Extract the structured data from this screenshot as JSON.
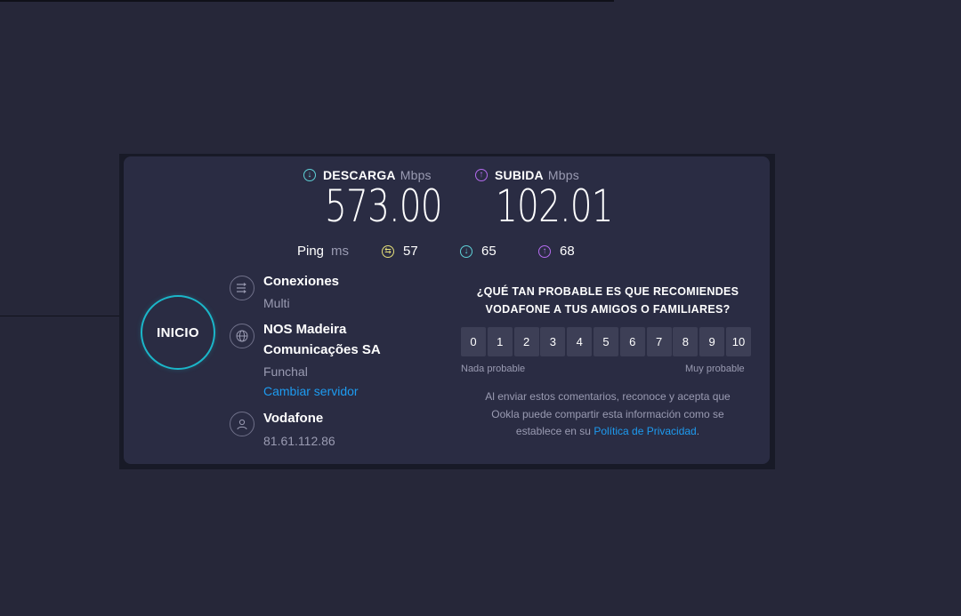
{
  "download": {
    "label": "DESCARGA",
    "unit": "Mbps",
    "value": "573.00",
    "icon": "arrow-down-circle-icon",
    "color": "#5fd1d8"
  },
  "upload": {
    "label": "SUBIDA",
    "unit": "Mbps",
    "value": "102.01",
    "icon": "arrow-up-circle-icon",
    "color": "#b56cf0"
  },
  "ping": {
    "label": "Ping",
    "unit": "ms",
    "idle": {
      "value": "57",
      "icon": "jitter-icon",
      "color": "#e6e07a"
    },
    "download": {
      "value": "65",
      "icon": "arrow-down-circle-icon",
      "color": "#5fd1d8"
    },
    "upload": {
      "value": "68",
      "icon": "arrow-up-circle-icon",
      "color": "#b56cf0"
    }
  },
  "start_button": {
    "label": "INICIO",
    "color": "#1bb6c9"
  },
  "connections": {
    "title": "Conexiones",
    "value": "Multi",
    "icon": "connections-icon"
  },
  "server": {
    "name_line1": "NOS Madeira",
    "name_line2": "Comunicações SA",
    "location": "Funchal",
    "change_label": "Cambiar servidor",
    "icon": "globe-icon"
  },
  "provider": {
    "name": "Vodafone",
    "ip": "81.61.112.86",
    "icon": "user-icon"
  },
  "survey": {
    "question_line1": "¿QUÉ TAN PROBABLE ES QUE RECOMIENDES",
    "question_line2": "VODAFONE A TUS AMIGOS O FAMILIARES?",
    "scale": [
      "0",
      "1",
      "2",
      "3",
      "4",
      "5",
      "6",
      "7",
      "8",
      "9",
      "10"
    ],
    "low_label": "Nada probable",
    "high_label": "Muy probable",
    "disclaimer_line1": "Al enviar estos comentarios, reconoce y acepta que",
    "disclaimer_line2": "Ookla puede compartir esta información como se",
    "disclaimer_line3_prefix": "establece en su",
    "privacy_link": "Política de Privacidad",
    "disclaimer_suffix": "."
  },
  "colors": {
    "background": "#262739",
    "card": "#2a2c43",
    "link": "#1d9bf0",
    "muted": "#9a9bb2"
  }
}
